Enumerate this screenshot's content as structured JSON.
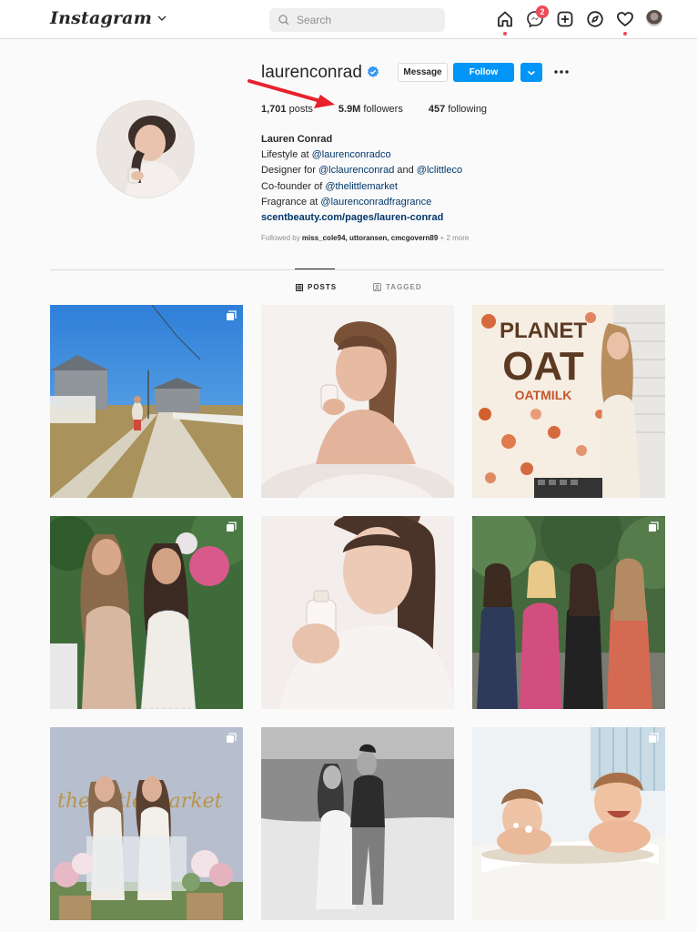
{
  "nav": {
    "logo": "Instagram",
    "search_placeholder": "Search",
    "messenger_badge": "2",
    "icons": [
      "home-icon",
      "messenger-icon",
      "new-post-icon",
      "explore-icon",
      "activity-heart-icon",
      "avatar"
    ]
  },
  "profile": {
    "username": "laurenconrad",
    "verified": true,
    "message_label": "Message",
    "follow_label": "Follow",
    "stats": {
      "posts_count": "1,701",
      "posts_label": "posts",
      "followers_count": "5.9M",
      "followers_label": "followers",
      "following_count": "457",
      "following_label": "following"
    },
    "bio": {
      "name": "Lauren Conrad",
      "line1_prefix": "Lifestyle at ",
      "line1_tag": "@laurenconradco",
      "line2_prefix": "Designer for ",
      "line2_tag1": "@lclaurenconrad",
      "line2_mid": " and ",
      "line2_tag2": "@lclittleco",
      "line3_prefix": "Co-founder of ",
      "line3_tag": "@thelittlemarket",
      "line4_prefix": "Fragrance at ",
      "line4_tag": "@laurenconradfragrance",
      "link": "scentbeauty.com/pages/lauren-conrad"
    },
    "followed_by": {
      "prefix": "Followed by ",
      "users": "miss_cole94, uttoransen, cmcgovern89",
      "suffix": " + 2 more"
    }
  },
  "tabs": [
    {
      "label": "POSTS",
      "active": true
    },
    {
      "label": "TAGGED",
      "active": false
    }
  ],
  "posts": [
    {
      "subject": "beach-road-cottages",
      "multi": true
    },
    {
      "subject": "portrait-perfume-bottle",
      "multi": false
    },
    {
      "subject": "planet-oat-banner",
      "multi": false,
      "banner_text": [
        "PLANET",
        "OAT",
        "OATMILK"
      ]
    },
    {
      "subject": "two-women-garden",
      "multi": true
    },
    {
      "subject": "perfume-closeup",
      "multi": false
    },
    {
      "subject": "group-of-four-women",
      "multi": true
    },
    {
      "subject": "the-little-market-event",
      "multi": true,
      "sign_text": "the little market"
    },
    {
      "subject": "couple-beach-bw",
      "multi": false
    },
    {
      "subject": "kids-in-bath",
      "multi": true
    }
  ],
  "colors": {
    "follow_blue": "#0095f6",
    "notification_red": "#ed4956",
    "annotation_arrow": "#e8212a",
    "link_blue": "#00376b"
  }
}
